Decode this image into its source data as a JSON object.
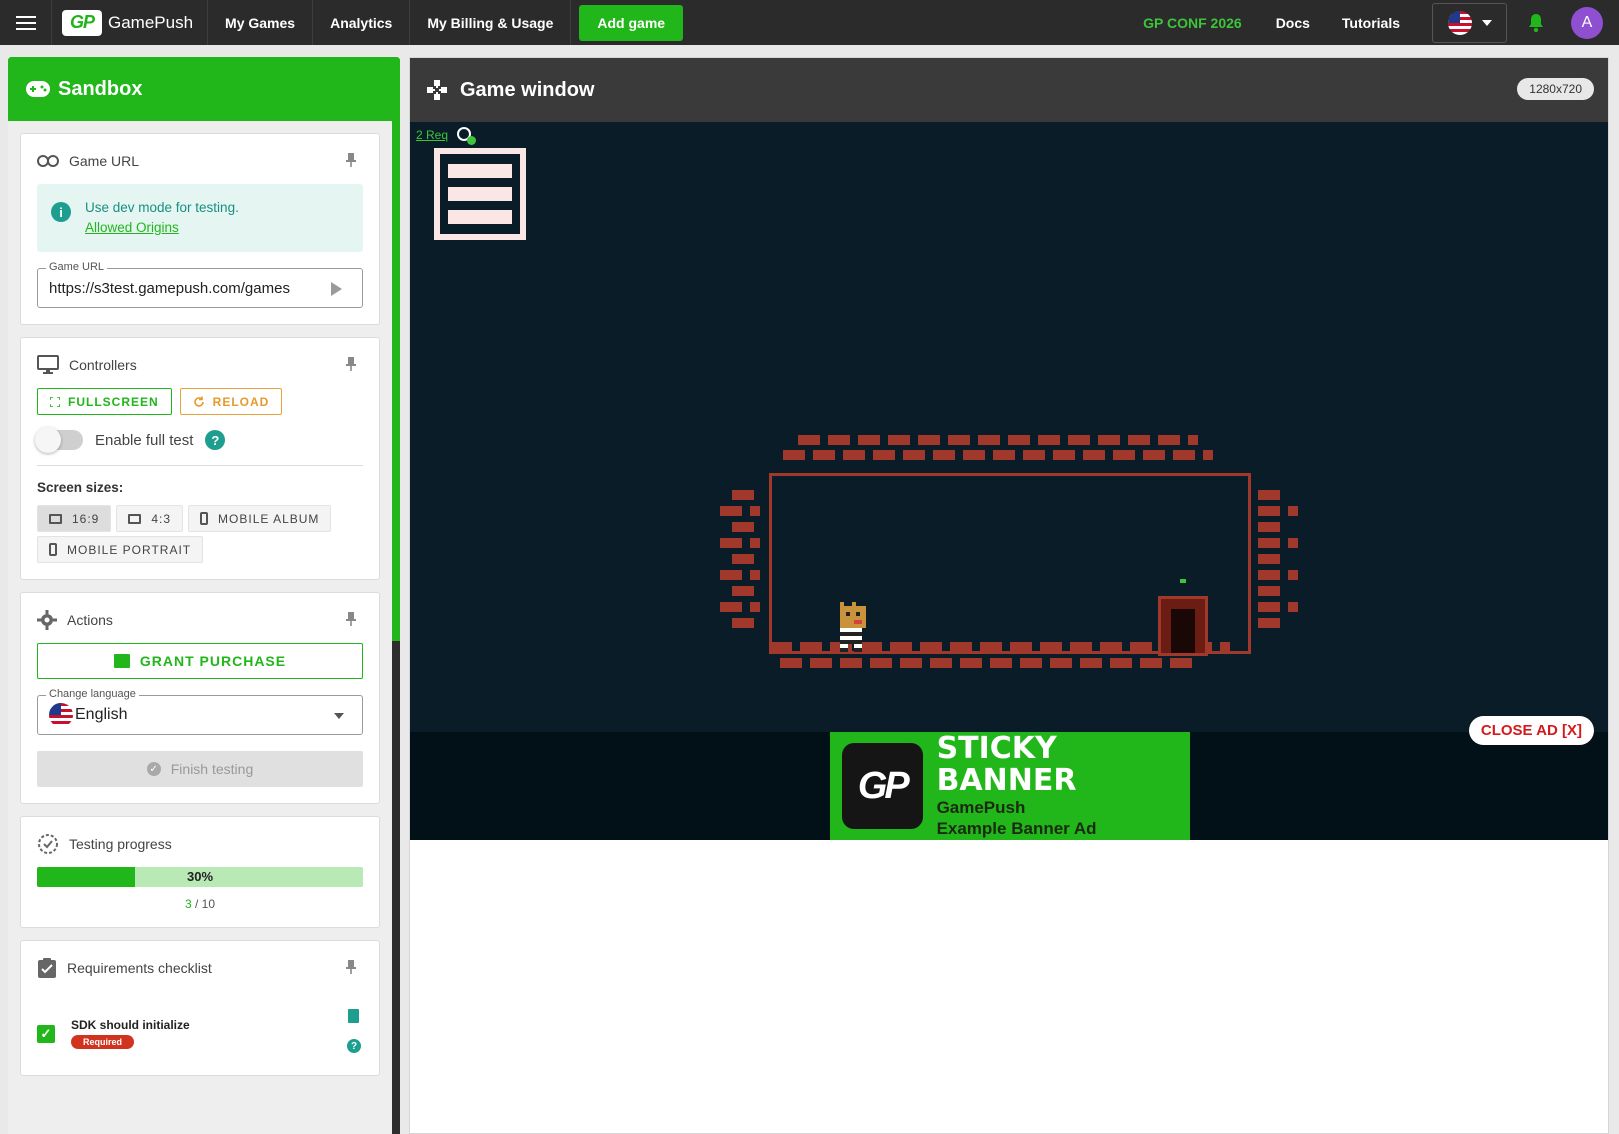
{
  "topbar": {
    "logo_badge": "GP",
    "logo_text": "GamePush",
    "nav": [
      "My Games",
      "Analytics",
      "My Billing & Usage"
    ],
    "add_game": "Add game",
    "conf": "GP CONF 2026",
    "docs": "Docs",
    "tutorials": "Tutorials",
    "avatar_letter": "A",
    "accent_color": "#21b71a"
  },
  "sidebar": {
    "title": "Sandbox",
    "game_url_card": {
      "title": "Game URL",
      "info_text": "Use dev mode for testing.",
      "info_link": "Allowed Origins",
      "field_label": "Game URL",
      "field_value": "https://s3test.gamepush.com/games"
    },
    "controllers_card": {
      "title": "Controllers",
      "fullscreen": "FULLSCREEN",
      "reload": "RELOAD",
      "full_test_label": "Enable full test",
      "full_test_enabled": false,
      "screen_sizes_label": "Screen sizes:",
      "sizes": [
        "16:9",
        "4:3",
        "MOBILE ALBUM",
        "MOBILE PORTRAIT"
      ],
      "selected_size": "16:9"
    },
    "actions_card": {
      "title": "Actions",
      "grant_purchase": "GRANT PURCHASE",
      "language_label": "Change language",
      "language_value": "English",
      "finish_testing": "Finish testing"
    },
    "progress_card": {
      "title": "Testing progress",
      "percent_label": "30%",
      "done": "3",
      "total": "10",
      "separator": "/",
      "progress_fraction": 0.3
    },
    "requirements_card": {
      "title": "Requirements checklist",
      "items": [
        {
          "name": "SDK should initialize",
          "badge": "Required",
          "checked": true
        }
      ]
    }
  },
  "game": {
    "title": "Game window",
    "resolution": "1280x720",
    "req_link": "2 Req",
    "ad": {
      "logo": "GP",
      "title": "STICKY BANNER",
      "line1": "GamePush",
      "line2": "Example Banner Ad",
      "close": "CLOSE AD [X]"
    }
  }
}
